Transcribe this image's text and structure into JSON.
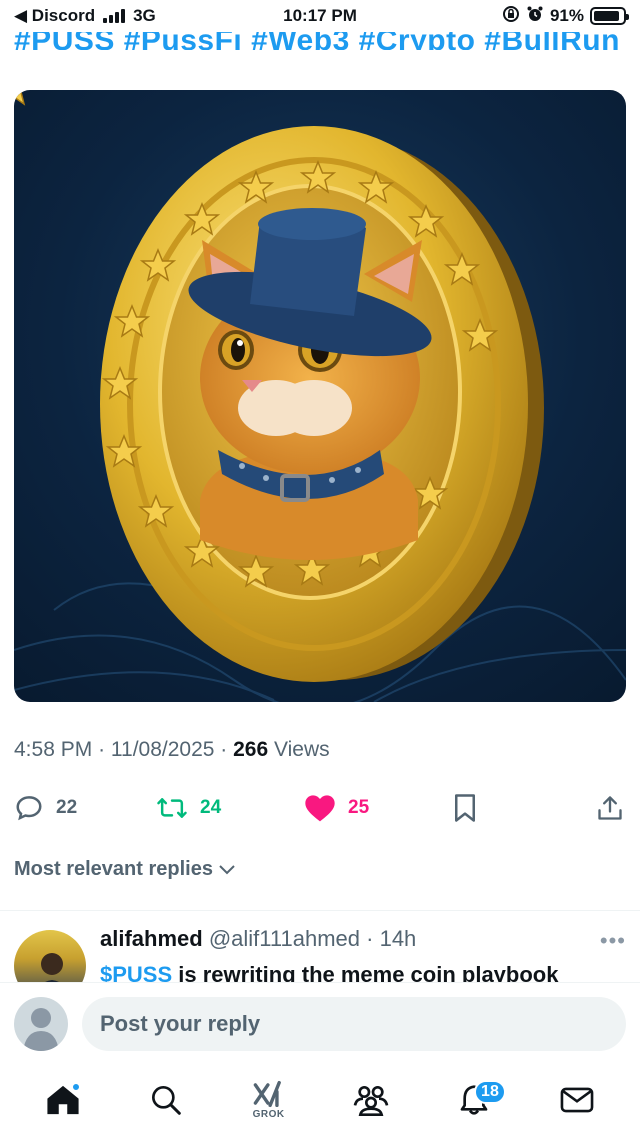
{
  "status_bar": {
    "back_label": "◀ Discord",
    "network": "3G",
    "time": "10:17 PM",
    "battery": "91%",
    "battery_level": 0.91
  },
  "tweet": {
    "hashtags": "#PUSS #PussFi #Web3 #Crypto #BullRun",
    "time": "4:58 PM",
    "date": "11/08/2025",
    "views_count": "266",
    "views_label": "Views",
    "replies": "22",
    "reposts": "24",
    "likes": "25"
  },
  "replies_sort": {
    "label": "Most relevant replies"
  },
  "reply": {
    "name": "alifahmed",
    "handle": "@alif111ahmed",
    "age": "14h",
    "cashtag": "$PUSS",
    "text": " is rewriting the meme coin playbook"
  },
  "compose": {
    "placeholder": "Post your reply"
  },
  "tabbar": {
    "grok_label": "GROK",
    "notifications_badge": "18"
  },
  "colors": {
    "accent": "#1d9bf0",
    "repost_green": "#00ba7c",
    "like_pink": "#f91880",
    "muted": "#536471"
  }
}
